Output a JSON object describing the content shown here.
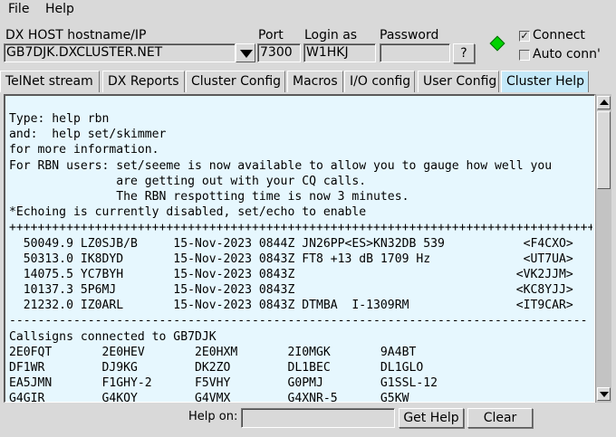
{
  "menu": {
    "file": "File",
    "help": "Help"
  },
  "connection": {
    "host_label": "DX HOST hostname/IP",
    "host_value": "GB7DJK.DXCLUSTER.NET",
    "port_label": "Port",
    "port_value": "7300",
    "login_label": "Login as",
    "login_value": "W1HKJ",
    "password_label": "Password",
    "password_value": "",
    "help_button": "?",
    "status_color": "#00d400",
    "connect_label": "Connect",
    "connect_checked": "✓",
    "auto_connect_label": "Auto conn'",
    "auto_connect_checked": ""
  },
  "tabs": [
    {
      "label": "TelNet stream"
    },
    {
      "label": "DX Reports"
    },
    {
      "label": "Cluster Config"
    },
    {
      "label": "Macros"
    },
    {
      "label": "I/O config"
    },
    {
      "label": "User Config"
    },
    {
      "label": "Cluster Help"
    }
  ],
  "active_tab_color": "#c4e8f8",
  "help_text": {
    "lines": [
      "Type: help rbn",
      "and:  help set/skimmer",
      "for more information.",
      "For RBN users: set/seeme is now available to allow you to gauge how well you",
      "               are getting out with your CQ calls.",
      "               The RBN respotting time is now 3 minutes.",
      "*Echoing is currently disabled, set/echo to enable",
      "++++++++++++++++++++++++++++++++++++++++++++++++++++++++++++++++++++++++++++++++++",
      "  50049.9 LZ0SJB/B     15-Nov-2023 0844Z JN26PP<ES>KN32DB 539           <F4CXO>",
      "  50313.0 IK8DYD       15-Nov-2023 0843Z FT8 +13 dB 1709 Hz             <UT7UA>",
      "  14075.5 YC7BYH       15-Nov-2023 0843Z                               <VK2JJM>",
      "  10137.3 5P6MJ        15-Nov-2023 0843Z                               <KC8YJJ>",
      "  21232.0 IZ0ARL       15-Nov-2023 0843Z DTMBA  I-1309RM               <IT9CAR>",
      "---------------------------------------------------------------------------------",
      "Callsigns connected to GB7DJK",
      "2E0FQT       2E0HEV       2E0HXM       2I0MGK       9A4BT",
      "DF1WR        DJ9KG        DK2ZO        DL1BEC       DL1GLO",
      "EA5JMN       F1GHY-2      F5VHY        G0PMJ        G1SSL-12",
      "G4GIR        G4KQY        G4VMX        G4XNR-5      G5KW"
    ]
  },
  "footer": {
    "help_on_label": "Help on:",
    "help_on_value": "",
    "get_help_button": "Get Help",
    "clear_button": "Clear"
  }
}
